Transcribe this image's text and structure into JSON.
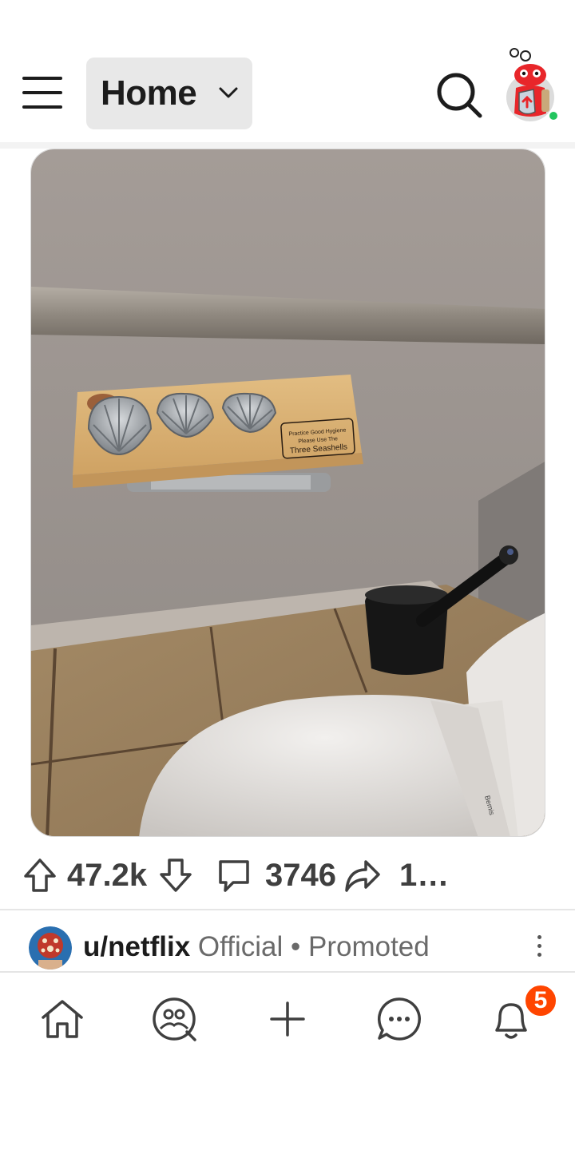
{
  "header": {
    "feed_label": "Home",
    "menu_icon": "hamburger-menu-icon",
    "search_icon": "search-icon",
    "avatar_icon": "snoo-avatar-icon",
    "online_status_color": "#22c55e"
  },
  "post": {
    "image_plaque_text": [
      "Practice Good Hygiene",
      "Please Use The",
      "Three Seashells"
    ],
    "upvotes": "47.2k",
    "comments": "3746",
    "shares": "1…"
  },
  "promoted": {
    "username": "u/netflix",
    "official_label": "Official",
    "separator": "•",
    "promoted_label": "Promoted"
  },
  "bottom_nav": {
    "items": [
      {
        "icon": "home-icon"
      },
      {
        "icon": "communities-icon"
      },
      {
        "icon": "create-plus-icon"
      },
      {
        "icon": "chat-icon"
      },
      {
        "icon": "notifications-bell-icon"
      }
    ],
    "notification_count": "5"
  },
  "colors": {
    "accent": "#ff4500",
    "pill_bg": "#e8e8e8",
    "muted_text": "#6a6a6a"
  }
}
